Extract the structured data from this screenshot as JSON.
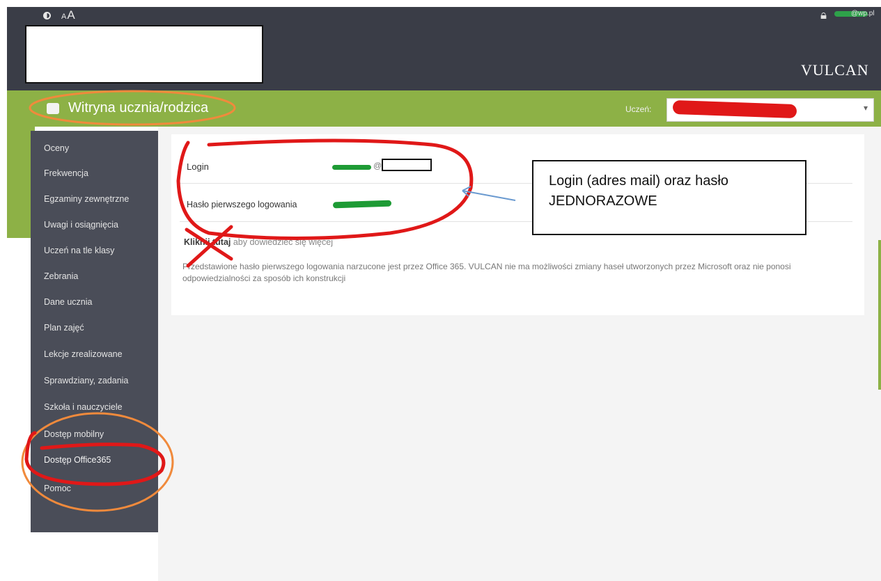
{
  "header": {
    "font_size_control": {
      "small": "A",
      "large": "A"
    },
    "user_email_suffix": "@wp.pl",
    "brand_logo": "VULCAN"
  },
  "app": {
    "title": "Witryna ucznia/rodzica",
    "student_label": "Uczeń:"
  },
  "sidebar": {
    "items": [
      {
        "label": "Oceny"
      },
      {
        "label": "Frekwencja"
      },
      {
        "label": "Egzaminy zewnętrzne"
      },
      {
        "label": "Uwagi i osiągnięcia"
      },
      {
        "label": "Uczeń na tle klasy"
      },
      {
        "label": "Zebrania"
      },
      {
        "label": "Dane ucznia"
      },
      {
        "label": "Plan zajęć"
      },
      {
        "label": "Lekcje zrealizowane"
      },
      {
        "label": "Sprawdziany, zadania"
      },
      {
        "label": "Szkoła i nauczyciele"
      },
      {
        "label": "Dostęp mobilny"
      },
      {
        "label": "Dostęp Office365"
      },
      {
        "label": "Pomoc"
      }
    ]
  },
  "content": {
    "login_label": "Login",
    "login_at": "@",
    "password_label": "Hasło pierwszego logowania",
    "click_link_strong": "Kliknij tutaj",
    "click_link_rest": " aby dowiedzieć się więcej",
    "note": "Przedstawione hasło pierwszego logowania narzucone jest przez Office 365. VULCAN nie ma możliwości zmiany haseł utworzonych przez Microsoft oraz nie ponosi odpowiedzialności za sposób ich konstrukcji"
  },
  "annotation": {
    "callout_line1": "Login (adres mail) oraz hasło",
    "callout_line2": "JEDNORAZOWE"
  },
  "colors": {
    "header_bg": "#3a3d47",
    "accent_green": "#8db146",
    "sidebar_bg": "#4a4d58",
    "marker_red": "#e01818",
    "marker_orange": "#f08a3c",
    "redaction_green": "#1e9b35"
  },
  "icons": {
    "contrast": "contrast-icon",
    "user": "user-icon",
    "app": "app-icon",
    "select": "chevron-down-icon"
  }
}
